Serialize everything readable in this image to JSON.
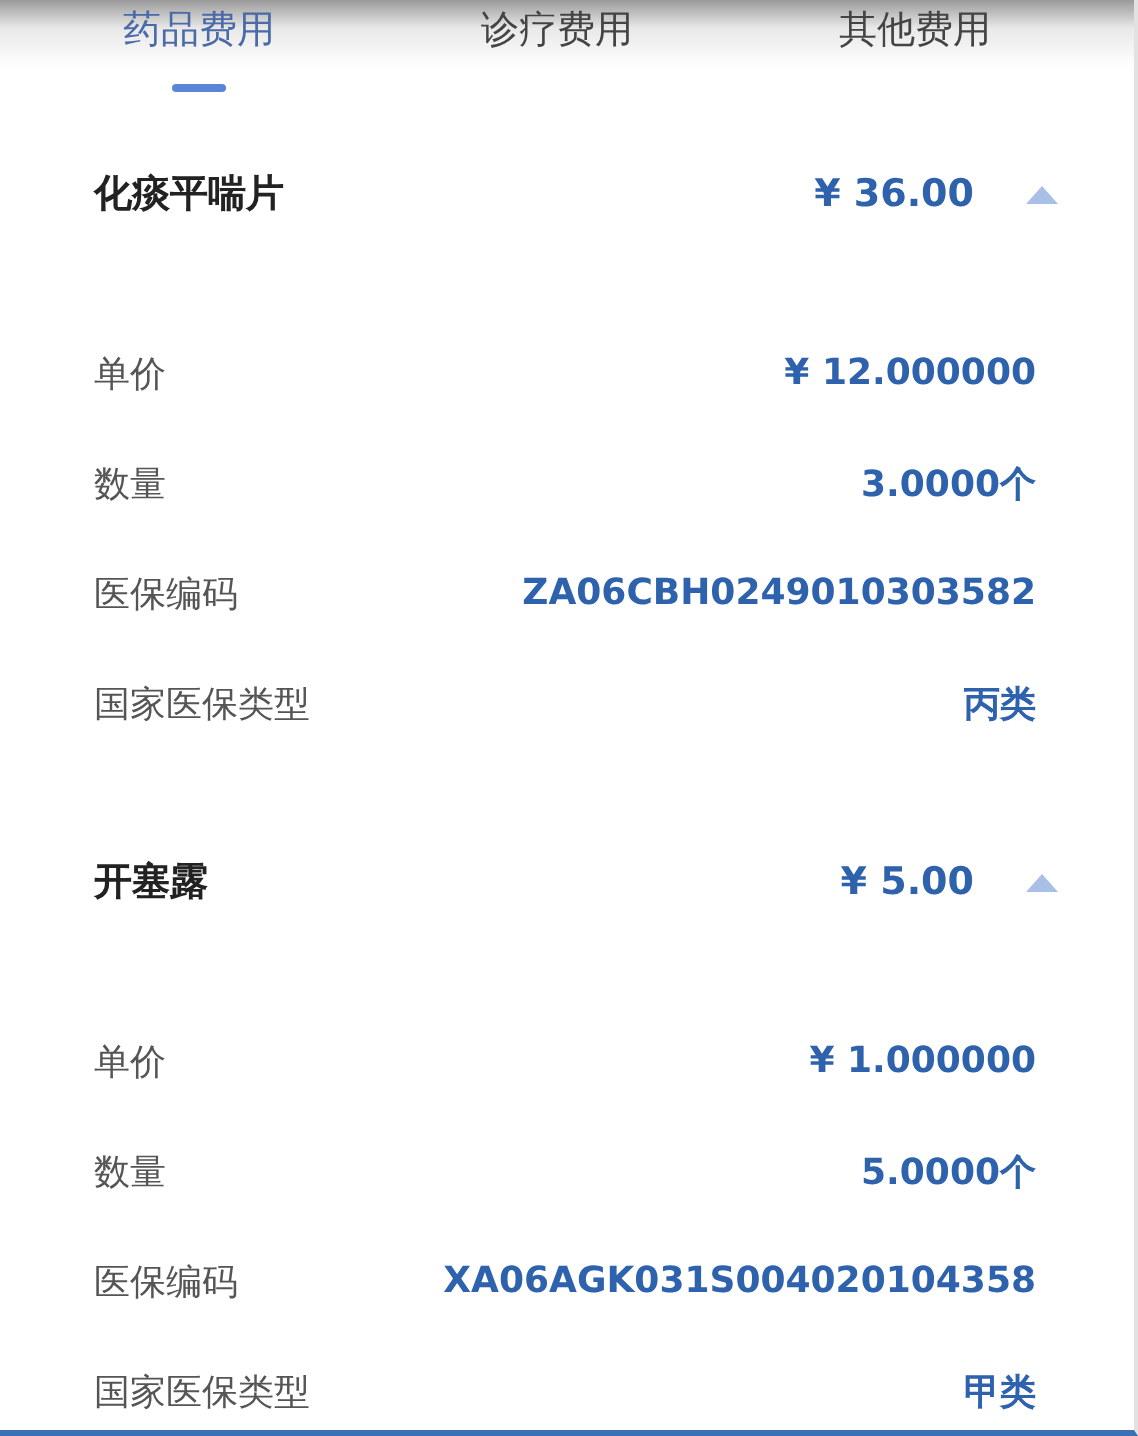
{
  "tabs": [
    {
      "label": "药品费用",
      "selected": true
    },
    {
      "label": "诊疗费用",
      "selected": false
    },
    {
      "label": "其他费用",
      "selected": false
    }
  ],
  "items": [
    {
      "name": "化痰平喘片",
      "amount": "¥ 36.00",
      "expanded": true,
      "details": [
        {
          "label": "单价",
          "value": "¥ 12.000000"
        },
        {
          "label": "数量",
          "value": "3.0000个"
        },
        {
          "label": "医保编码",
          "value": "ZA06CBH0249010303582"
        },
        {
          "label": "国家医保类型",
          "value": "丙类"
        }
      ]
    },
    {
      "name": "开塞露",
      "amount": "¥ 5.00",
      "expanded": true,
      "details": [
        {
          "label": "单价",
          "value": "¥ 1.000000"
        },
        {
          "label": "数量",
          "value": "5.0000个"
        },
        {
          "label": "医保编码",
          "value": "XA06AGK031S004020104358"
        },
        {
          "label": "国家医保类型",
          "value": "甲类"
        }
      ]
    }
  ]
}
